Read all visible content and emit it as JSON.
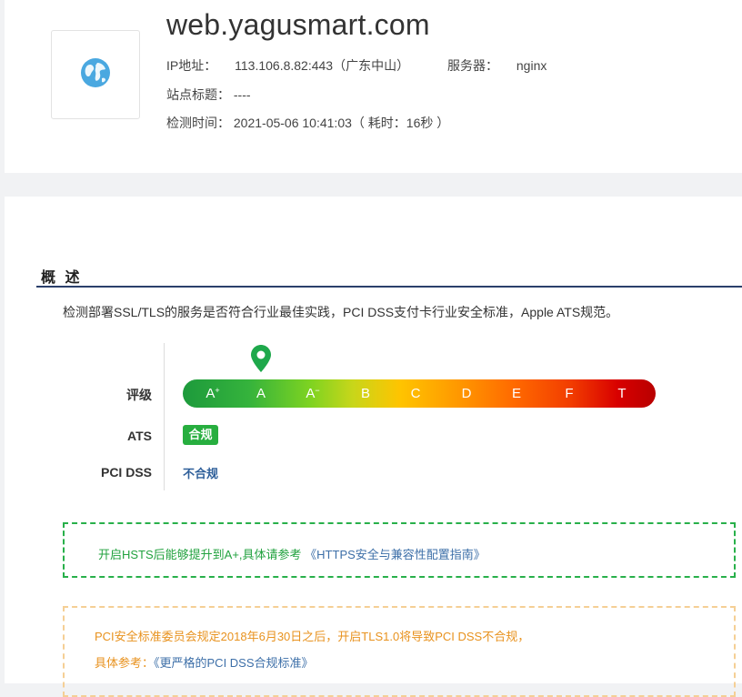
{
  "site": {
    "domain": "web.yagusmart.com",
    "ip_label": "IP地址：",
    "ip_value": "113.106.8.82:443（广东中山）",
    "server_label": "服务器：",
    "server_value": "nginx",
    "title_label": "站点标题：",
    "title_value": "----",
    "time_label": "检测时间：",
    "time_value": "2021-05-06 10:41:03（ 耗时：16秒 ）",
    "thumb_icon": "globe-icon"
  },
  "overview": {
    "title": "概 述",
    "description": "检测部署SSL/TLS的服务是否符合行业最佳实践，PCI DSS支付卡行业安全标准，Apple ATS规范。",
    "grade_label": "评级",
    "grades": [
      "A+",
      "A",
      "A-",
      "B",
      "C",
      "D",
      "E",
      "F",
      "T"
    ],
    "current_grade": "A",
    "ats_label": "ATS",
    "ats_status": "合规",
    "pci_label": "PCI DSS",
    "pci_status": "不合规",
    "colors": {
      "compliant": "#27ae3f",
      "noncompliant": "#2e5f9a",
      "pin": "#1ea84b",
      "section_line": "#2b3f6b"
    }
  },
  "tips": {
    "hsts_text": "开启HSTS后能够提升到A+,具体请参考 ",
    "hsts_link": "《HTTPS安全与兼容性配置指南》",
    "pci_line1": "PCI安全标准委员会规定2018年6月30日之后，开启TLS1.0将导致PCI DSS不合规，",
    "pci_ref_label": "具体参考：",
    "pci_link": "《更严格的PCI DSS合规标准》"
  }
}
